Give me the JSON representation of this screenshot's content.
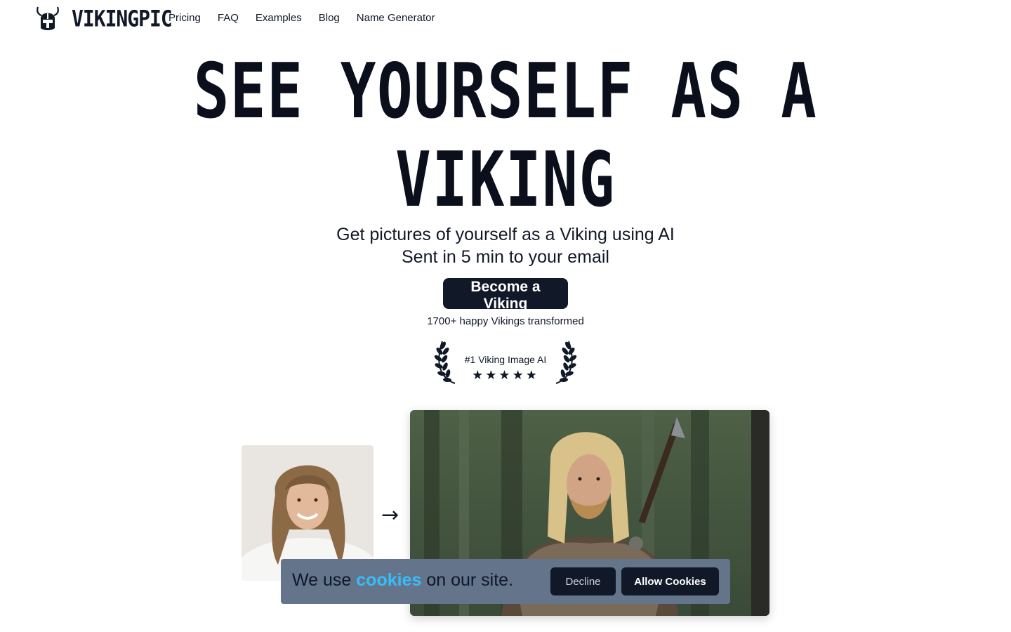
{
  "header": {
    "logo_text": "VIKINGPIC",
    "logo_icon": "viking-helmet-icon",
    "nav": [
      {
        "label": "Pricing"
      },
      {
        "label": "FAQ"
      },
      {
        "label": "Examples"
      },
      {
        "label": "Blog"
      },
      {
        "label": "Name Generator"
      }
    ]
  },
  "hero": {
    "title_line1": "SEE YOURSELF AS A",
    "title_line2": "VIKING",
    "subtitle_line1": "Get pictures of yourself as a Viking using AI",
    "subtitle_line2": "Sent in 5 min to your email",
    "cta_label": "Become a Viking",
    "happy_count": "1700+ happy Vikings transformed",
    "badge_text": "#1 Viking Image AI",
    "rating_stars": 5
  },
  "comparison": {
    "arrow": "→",
    "before_image": "person-portrait",
    "after_image": "viking-portrait"
  },
  "cookie_banner": {
    "text_before": "We use",
    "link_text": "cookies",
    "text_after": "on our site.",
    "decline_label": "Decline",
    "allow_label": "Allow Cookies"
  },
  "colors": {
    "primary_dark": "#111827",
    "cookie_bg": "#64748b",
    "cookie_link": "#38bdf8"
  }
}
